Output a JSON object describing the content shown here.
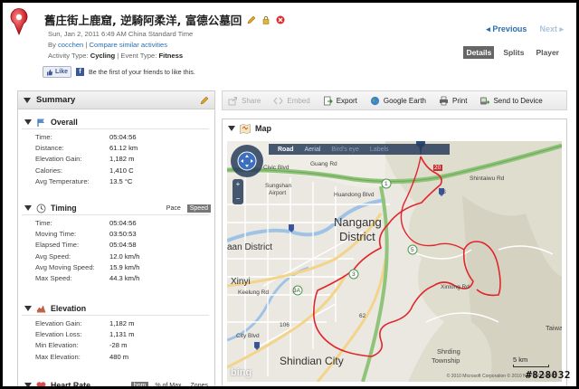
{
  "header": {
    "title": "舊庄街上鹿窟, 逆騎阿柔洋, 富德公墓回",
    "datetime": "Sun, Jan 2, 2011 6:49 AM China Standard Time",
    "by_label": "By",
    "author": "cocchen",
    "separator": "|",
    "compare_link": "Compare similar activities",
    "activity_type_label": "Activity Type:",
    "activity_type": "Cycling",
    "event_type_label": "Event Type:",
    "event_type": "Fitness",
    "like_label": "Like",
    "like_text": "Be the first of your friends to like this.",
    "previous": "Previous",
    "next": "Next"
  },
  "tabs": [
    "Details",
    "Splits",
    "Player"
  ],
  "toolbar": {
    "share": "Share",
    "embed": "Embed",
    "export": "Export",
    "google_earth": "Google Earth",
    "print": "Print",
    "send_to_device": "Send to Device"
  },
  "summary": {
    "title": "Summary",
    "overall": {
      "title": "Overall",
      "rows": [
        {
          "label": "Time:",
          "value": "05:04:56"
        },
        {
          "label": "Distance:",
          "value": "61.12 km"
        },
        {
          "label": "Elevation Gain:",
          "value": "1,182 m"
        },
        {
          "label": "Calories:",
          "value": "1,410 C"
        },
        {
          "label": "Avg Temperature:",
          "value": "13.5 °C"
        }
      ]
    },
    "timing": {
      "title": "Timing",
      "toggle": [
        "Pace",
        "Speed"
      ],
      "rows": [
        {
          "label": "Time:",
          "value": "05:04:56"
        },
        {
          "label": "Moving Time:",
          "value": "03:50:53"
        },
        {
          "label": "Elapsed Time:",
          "value": "05:04:58"
        },
        {
          "label": "Avg Speed:",
          "value": "12.0 km/h"
        },
        {
          "label": "Avg Moving Speed:",
          "value": "15.9 km/h"
        },
        {
          "label": "Max Speed:",
          "value": "44.3 km/h"
        }
      ]
    },
    "elevation": {
      "title": "Elevation",
      "rows": [
        {
          "label": "Elevation Gain:",
          "value": "1,182 m"
        },
        {
          "label": "Elevation Loss:",
          "value": "1,131 m"
        },
        {
          "label": "Min Elevation:",
          "value": "-28 m"
        },
        {
          "label": "Max Elevation:",
          "value": "480 m"
        }
      ]
    },
    "heart_rate": {
      "title": "Heart Rate",
      "toggle": [
        "bpm",
        "% of Max",
        "Zones"
      ]
    }
  },
  "map": {
    "title": "Map",
    "types": [
      "Road",
      "Aerial",
      "Bird's eye",
      "Labels"
    ],
    "labels": {
      "nangang": "Nangang",
      "district": "District",
      "daan": "aan District",
      "xinyi": "Xinyi",
      "shindian": "Shindian City",
      "shrding": "Shrding",
      "township": "Township",
      "taiwa": "Taiwa",
      "sungshan": "Sungshan",
      "airport": "Airport",
      "huandong": "Huandong Blvd",
      "shintaiwu": "Shintaiwu Rd",
      "guang": "Guang Rd",
      "keelung": "Keelung Rd",
      "civic": "Civic Blvd",
      "xinlong": "Xinlong Rd",
      "cityblvd": "City Blvd",
      "road_106": "106",
      "road_62": "62",
      "shield_1": "1",
      "shield_3": "3",
      "shield_3a": "3A",
      "shield_5a": "5",
      "shield_5b": "5",
      "shield_9": "9",
      "shield_2b": "2B",
      "shield_20": "20"
    },
    "scale": "5 km",
    "copyright": "© 2010 Microsoft Corporation  © 2010 NAVTEQ  © AND",
    "bing": "bing"
  },
  "watermark": "#828032",
  "colors": {
    "link": "#2a6fb0",
    "track": "#e0262a",
    "highway": "#8fc47a",
    "water": "#9fc3e6"
  }
}
